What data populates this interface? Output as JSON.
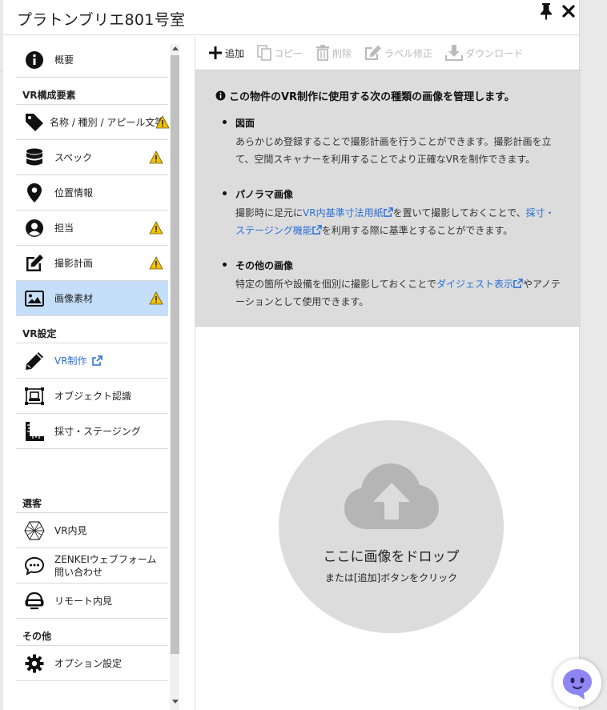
{
  "window": {
    "title": "プラトンブリエ801号室"
  },
  "sidebar": {
    "top_items": [
      {
        "label": "概要",
        "icon": "info-circle-icon"
      }
    ],
    "sections": [
      {
        "title": "VR構成要素"
      },
      {
        "title": "VR設定"
      },
      {
        "title": "選客"
      },
      {
        "title": "その他"
      }
    ],
    "vr_items": [
      {
        "label": "名称 / 種別 / アピール文等",
        "icon": "tag-icon",
        "warning": true
      },
      {
        "label": "スペック",
        "icon": "database-icon",
        "warning": true
      },
      {
        "label": "位置情報",
        "icon": "map-pin-icon",
        "warning": false
      },
      {
        "label": "担当",
        "icon": "user-circle-icon",
        "warning": true
      },
      {
        "label": "撮影計画",
        "icon": "edit-icon",
        "warning": true
      },
      {
        "label": "画像素材",
        "icon": "image-icon",
        "warning": true,
        "active": true
      }
    ],
    "settings_items": [
      {
        "label": "VR制作",
        "icon": "pencil-icon",
        "external": true
      },
      {
        "label": "オブジェクト認識",
        "icon": "object-frame-icon"
      },
      {
        "label": "採寸・ステージング",
        "icon": "ruler-icon"
      }
    ],
    "customer_items": [
      {
        "label": "VR内見",
        "icon": "vr-polyhedron-icon"
      },
      {
        "label": "ZENKEIウェブフォーム",
        "label2": "問い合わせ",
        "icon": "chat-icon"
      },
      {
        "label": "リモート内見",
        "icon": "headset-icon"
      }
    ],
    "other_items": [
      {
        "label": "オプション設定",
        "icon": "gear-icon"
      }
    ]
  },
  "toolbar": {
    "add": "追加",
    "copy": "コピー",
    "delete": "削除",
    "label_edit": "ラベル修正",
    "download": "ダウンロード"
  },
  "info": {
    "heading": "この物件のVR制作に使用する次の種類の画像を管理します。",
    "items": [
      {
        "title": "図面",
        "text": "あらかじめ登録することで撮影計画を行うことができます。撮影計画を立て、空間スキャナーを利用することでより正確なVRを制作できます。"
      },
      {
        "title": "パノラマ画像",
        "text_a": "撮影時に足元に",
        "link1": "VR内基準寸法用紙",
        "text_b": "を置いて撮影しておくことで、",
        "link2": "採寸・ステージング機能",
        "text_c": "を利用する際に基準とすることができます。"
      },
      {
        "title": "その他の画像",
        "text_a": "特定の箇所や設備を個別に撮影しておくことで",
        "link1": "ダイジェスト表示",
        "text_b": "やアノテーションとして使用できます。"
      }
    ]
  },
  "dropzone": {
    "title": "ここに画像をドロップ",
    "subtitle": "または[追加]ボタンをクリック"
  },
  "colors": {
    "active_bg": "#c5defa",
    "link": "#2b6fd6",
    "warning": "#f2c300",
    "chat_accent": "#8e86f0"
  }
}
